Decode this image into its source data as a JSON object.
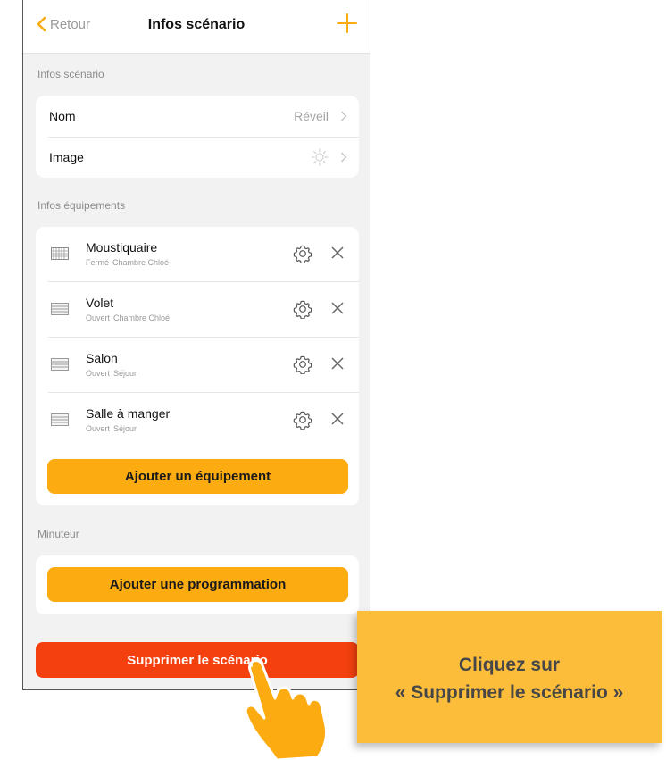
{
  "navbar": {
    "back_label": "Retour",
    "title": "Infos scénario",
    "add_icon": "plus-icon"
  },
  "scenario_info": {
    "section_label": "Infos scénario",
    "rows": [
      {
        "label": "Nom",
        "value": "Réveil"
      },
      {
        "label": "Image",
        "value_icon": "sun-icon"
      }
    ]
  },
  "equipment": {
    "section_label": "Infos équipements",
    "items": [
      {
        "name": "Moustiquaire",
        "state": "Fermé",
        "room": "Chambre Chloé",
        "icon": "mosquito-net-icon"
      },
      {
        "name": "Volet",
        "state": "Ouvert",
        "room": "Chambre Chloé",
        "icon": "shutter-icon"
      },
      {
        "name": "Salon",
        "state": "Ouvert",
        "room": "Séjour",
        "icon": "shutter-icon"
      },
      {
        "name": "Salle à manger",
        "state": "Ouvert",
        "room": "Séjour",
        "icon": "shutter-icon"
      }
    ],
    "add_button": "Ajouter un équipement"
  },
  "timer": {
    "section_label": "Minuteur",
    "add_button": "Ajouter une programmation"
  },
  "delete_button": "Supprimer le scénario",
  "callout": {
    "line1": "Cliquez sur",
    "line2": "« Supprimer le scénario »"
  },
  "colors": {
    "accent": "#fcab10",
    "danger": "#f4400f",
    "callout_bg": "#fbbd3a"
  }
}
